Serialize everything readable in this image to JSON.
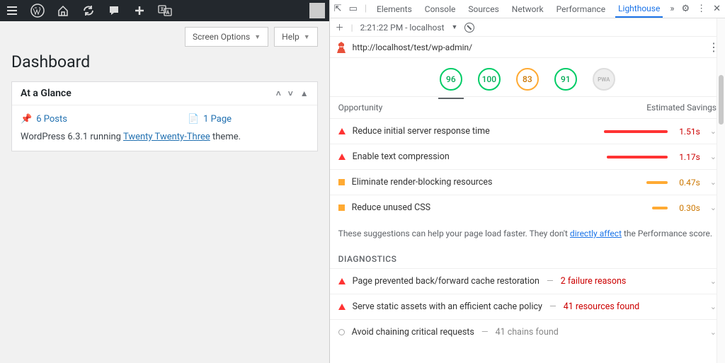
{
  "wp": {
    "top_buttons": {
      "screen_options": "Screen Options",
      "help": "Help"
    },
    "page_title": "Dashboard",
    "panel": {
      "title": "At a Glance",
      "posts": "6 Posts",
      "pages": "1 Page",
      "version_prefix": "WordPress 6.3.1 running ",
      "theme": "Twenty Twenty-Three",
      "version_suffix": " theme."
    }
  },
  "devtools": {
    "tabs": [
      "Elements",
      "Console",
      "Sources",
      "Network",
      "Performance",
      "Lighthouse"
    ],
    "active_tab": "Lighthouse",
    "time_host": "2:21:22 PM - localhost",
    "url": "http://localhost/test/wp-admin/",
    "scores": [
      {
        "value": "96",
        "class": "green active-under"
      },
      {
        "value": "100",
        "class": "green"
      },
      {
        "value": "83",
        "class": "orange"
      },
      {
        "value": "91",
        "class": "green"
      },
      {
        "value": "PWA",
        "class": "grey"
      }
    ],
    "opp_header": {
      "left": "Opportunity",
      "right": "Estimated Savings"
    },
    "opportunities": [
      {
        "mark": "tri-red",
        "label": "Reduce initial server response time",
        "bar": "red",
        "time": "1.51s",
        "time_class": "red"
      },
      {
        "mark": "tri-red",
        "label": "Enable text compression",
        "bar": "red2",
        "time": "1.17s",
        "time_class": "red"
      },
      {
        "mark": "sq-orange",
        "label": "Eliminate render-blocking resources",
        "bar": "or1",
        "time": "0.47s",
        "time_class": "orange"
      },
      {
        "mark": "sq-orange",
        "label": "Reduce unused CSS",
        "bar": "or2",
        "time": "0.30s",
        "time_class": "orange"
      }
    ],
    "note_prefix": "These suggestions can help your page load faster. They don't ",
    "note_link": "directly affect",
    "note_suffix": " the Performance score.",
    "diagnostics_title": "DIAGNOSTICS",
    "diagnostics": [
      {
        "mark": "tri-red",
        "label": "Page prevented back/forward cache restoration",
        "extra": "2 failure reasons",
        "extra_class": ""
      },
      {
        "mark": "tri-red",
        "label": "Serve static assets with an efficient cache policy",
        "extra": "41 resources found",
        "extra_class": ""
      },
      {
        "mark": "circ",
        "label": "Avoid chaining critical requests",
        "extra": "41 chains found",
        "extra_class": "grey"
      }
    ]
  }
}
